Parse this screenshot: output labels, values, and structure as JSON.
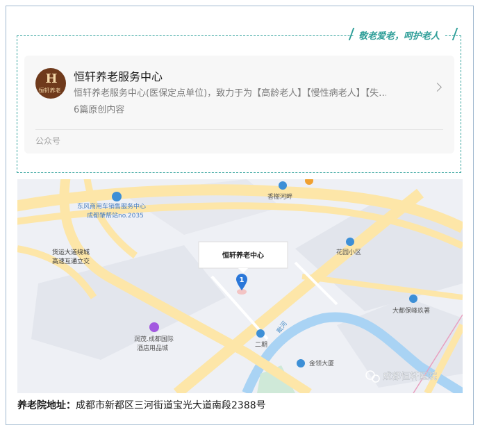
{
  "slogan": "敬老爱老，呵护老人",
  "account": {
    "logo_text_top": "H",
    "logo_text_bottom": "恒轩养老",
    "name": "恒轩养老服务中心",
    "description": "恒轩养老服务中心(医保定点单位)，致力于为【高龄老人】【慢性病老人】【失…",
    "article_count": "6篇原创内容",
    "type": "公众号"
  },
  "map": {
    "marker_title": "恒轩养老中心",
    "marker_number": "1",
    "watermark": "成都恒轩医院",
    "pois": [
      {
        "label": "香榭河畔"
      },
      {
        "label": "东风商用车销售服务中心"
      },
      {
        "label": "成都肇帮站no.2035"
      },
      {
        "label": "货运大道绕城"
      },
      {
        "label": "高速互通立交"
      },
      {
        "label": "花园小区"
      },
      {
        "label": "大都保峰玖著"
      },
      {
        "label": "润茂.成都国际"
      },
      {
        "label": "酒店用品城"
      },
      {
        "label": "二期"
      },
      {
        "label": "金领大厦"
      },
      {
        "label": "毗河"
      }
    ]
  },
  "address": {
    "label": "养老院地址：",
    "value": "成都市新都区三河街道宝光大道南段2388号"
  }
}
